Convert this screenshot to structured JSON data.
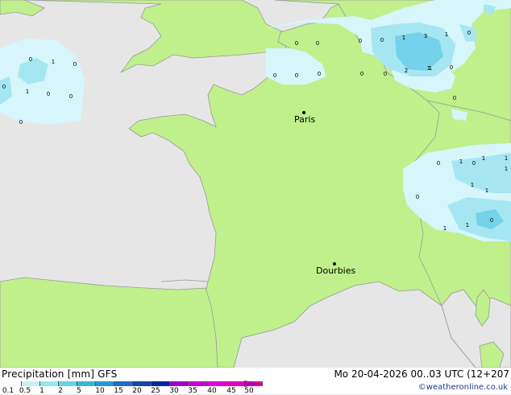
{
  "map": {
    "cities": [
      {
        "name": "Paris"
      },
      {
        "name": "Dourbies"
      }
    ],
    "precip_numbers": [
      "0",
      "1",
      "0",
      "0",
      "1",
      "0",
      "0",
      "0",
      "0",
      "0",
      "0",
      "0",
      "0",
      "0",
      "0",
      "0",
      "1",
      "3",
      "1",
      "0",
      "0",
      "1",
      "2",
      "1",
      "0",
      "0",
      "0",
      "0",
      "1",
      "1",
      "1",
      "0",
      "1",
      "1",
      "0",
      "1",
      "1",
      "1"
    ]
  },
  "footer": {
    "title": "Precipitation [mm]  GFS",
    "datetime": "Mo 20-04-2026 00..03 UTC (12+207",
    "credit": "©weatheronline.co.uk",
    "scale_labels": [
      "0.1",
      "0.5",
      "1",
      "2",
      "5",
      "10",
      "15",
      "20",
      "25",
      "30",
      "35",
      "40",
      "45",
      "50"
    ],
    "scale_colors": [
      "#ffffff",
      "#c8f0f8",
      "#96e6f0",
      "#64d2e8",
      "#3cb4dc",
      "#2896d2",
      "#1e6ec8",
      "#1446aa",
      "#0a2896",
      "#a000c8",
      "#c800d2",
      "#dc00dc",
      "#e600b4",
      "#f0009b"
    ]
  }
}
